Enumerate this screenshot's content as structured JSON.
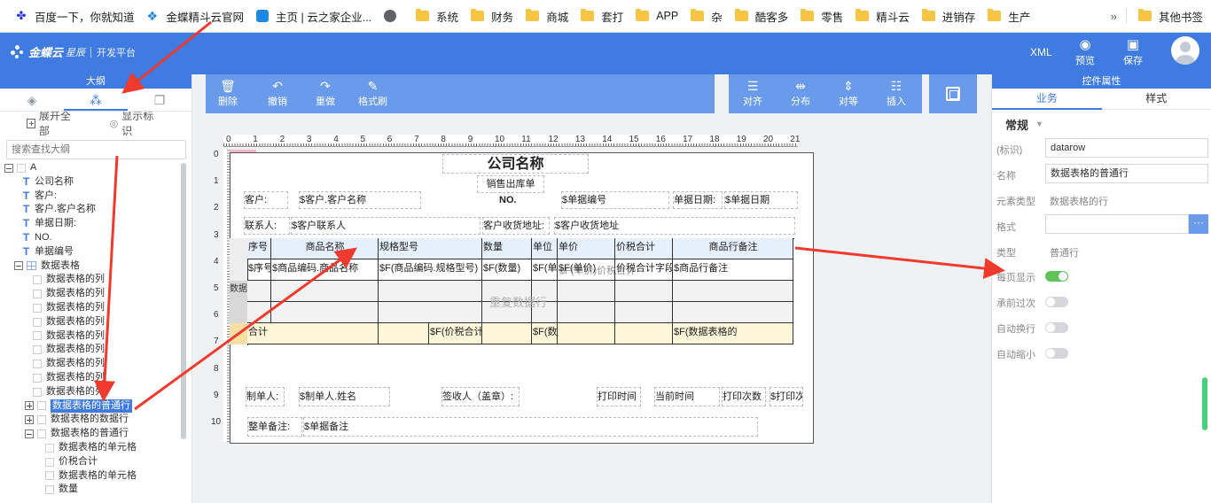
{
  "bookmarks": [
    {
      "label": "百度一下，你就知道",
      "icon": "baidu-icon"
    },
    {
      "label": "金蝶精斗云官网",
      "icon": "kingdee-icon"
    },
    {
      "label": "主页 | 云之家企业...",
      "icon": "cloud-icon"
    },
    {
      "label": "",
      "icon": "globe-icon"
    },
    {
      "label": "系统",
      "icon": "folder-icon"
    },
    {
      "label": "财务",
      "icon": "folder-icon"
    },
    {
      "label": "商城",
      "icon": "folder-icon"
    },
    {
      "label": "套打",
      "icon": "folder-icon"
    },
    {
      "label": "APP",
      "icon": "folder-icon"
    },
    {
      "label": "杂",
      "icon": "folder-icon"
    },
    {
      "label": "酷客多",
      "icon": "folder-icon"
    },
    {
      "label": "零售",
      "icon": "folder-icon"
    },
    {
      "label": "精斗云",
      "icon": "folder-icon"
    },
    {
      "label": "进销存",
      "icon": "folder-icon"
    },
    {
      "label": "生产",
      "icon": "folder-icon"
    }
  ],
  "bookmarks_more": "»",
  "bookmarks_other": "其他书签",
  "header": {
    "logo_name": "金蝶云",
    "logo_sub": "星辰",
    "logo_platform": "开发平台",
    "xml": "XML",
    "preview": "预览",
    "save": "保存"
  },
  "outline": {
    "title": "大纲",
    "expand_all": "展开全部",
    "show_marks": "显示标识",
    "search_placeholder": "搜索查找大纲",
    "nodes": [
      {
        "label": "A",
        "kind": "root"
      },
      {
        "label": "公司名称",
        "kind": "text"
      },
      {
        "label": "客户:",
        "kind": "text"
      },
      {
        "label": "客户.客户名称",
        "kind": "text"
      },
      {
        "label": "单据日期:",
        "kind": "text"
      },
      {
        "label": "NO.",
        "kind": "text"
      },
      {
        "label": "单据编号",
        "kind": "text"
      },
      {
        "label": "数据表格",
        "kind": "grid"
      },
      {
        "label": "数据表格的列",
        "kind": "item"
      },
      {
        "label": "数据表格的列",
        "kind": "item"
      },
      {
        "label": "数据表格的列",
        "kind": "item"
      },
      {
        "label": "数据表格的列",
        "kind": "item"
      },
      {
        "label": "数据表格的列",
        "kind": "item"
      },
      {
        "label": "数据表格的列",
        "kind": "item"
      },
      {
        "label": "数据表格的列",
        "kind": "item"
      },
      {
        "label": "数据表格的列",
        "kind": "item"
      },
      {
        "label": "数据表格的列",
        "kind": "item"
      },
      {
        "label": "数据表格的普通行",
        "kind": "row-selected"
      },
      {
        "label": "数据表格的数据行",
        "kind": "row"
      },
      {
        "label": "数据表格的普通行",
        "kind": "row-open"
      },
      {
        "label": "数据表格的单元格",
        "kind": "cell"
      },
      {
        "label": "价税合计",
        "kind": "cell"
      },
      {
        "label": "数据表格的单元格",
        "kind": "cell"
      },
      {
        "label": "数量",
        "kind": "cell"
      }
    ]
  },
  "toolbar": {
    "delete": "删除",
    "undo": "撤销",
    "redo": "重做",
    "format_brush": "格式刷",
    "align": "对齐",
    "distribute": "分布",
    "equal": "对等",
    "insert": "插入"
  },
  "rulers": {
    "h": [
      "0",
      "1",
      "2",
      "3",
      "4",
      "5",
      "6",
      "7",
      "8",
      "9",
      "10",
      "11",
      "12",
      "13",
      "14",
      "15",
      "16",
      "17",
      "18",
      "19",
      "20",
      "21"
    ],
    "v": [
      "0",
      "1",
      "2",
      "3",
      "4",
      "5",
      "6",
      "7",
      "8",
      "9",
      "10"
    ]
  },
  "report": {
    "company": "公司名称",
    "doc_title": "销售出库单",
    "customer_label": "客户:",
    "customer_value": "$客户.客户名称",
    "no_label": "NO.",
    "no_value": "$单据编号",
    "date_label": "单据日期:",
    "date_value": "$单据日期",
    "contact_label": "联系人:",
    "contact_value": "$客户联系人",
    "addr_label": "客户收货地址:",
    "addr_value": "$客户收货地址",
    "grid_header": [
      "序号",
      "商品名称",
      "规格型号",
      "数量",
      "单位",
      "单价",
      "价税合计",
      "商品行备注"
    ],
    "grid_data": [
      "$序号",
      "$商品编码.商品名称",
      "$F(商品编码.规格型号)",
      "$F(数量)",
      "$F(单位",
      "$F(单价)",
      "价税合计字段",
      "$商品行备注"
    ],
    "grid_data_overlay": "$F(单价)价税合计",
    "grid_side": "数据",
    "repeat_label": "重复数据行",
    "total_row": [
      "合计",
      "",
      "$F(价税合计",
      "",
      "$F(数量)",
      "",
      "",
      "$F(数据表格的",
      ""
    ],
    "maker_label": "制单人:",
    "maker_value": "$制单人.姓名",
    "sign_label": "签收人（盖章）:",
    "print_time": "打印时间",
    "current_time": "当前时间",
    "print_count": "打印次数",
    "print_count_value": "$打印次",
    "remark_label": "整单备注:",
    "remark_value": "$单据备注"
  },
  "props": {
    "title": "控件属性",
    "tab_business": "业务",
    "tab_style": "样式",
    "section": "常规",
    "id_label": "(标识)",
    "id_value": "datarow",
    "name_label": "名称",
    "name_value": "数据表格的普通行",
    "elem_type_label": "元素类型",
    "elem_type_value": "数据表格的行",
    "format_label": "格式",
    "format_value": "",
    "format_more": "···",
    "type_label": "类型",
    "type_value": "普通行",
    "every_page_label": "每页显示",
    "every_page_on": true,
    "carry_label": "承前过次",
    "carry_on": false,
    "auto_wrap_label": "自动换行",
    "auto_wrap_on": false,
    "auto_shrink_label": "自动缩小",
    "auto_shrink_on": false
  },
  "colors": {
    "header_blue": "#3f7be0",
    "toolbar_blue": "#6a9bea",
    "arrow_red": "#f03a2e",
    "toggle_green": "#5ec45a"
  }
}
